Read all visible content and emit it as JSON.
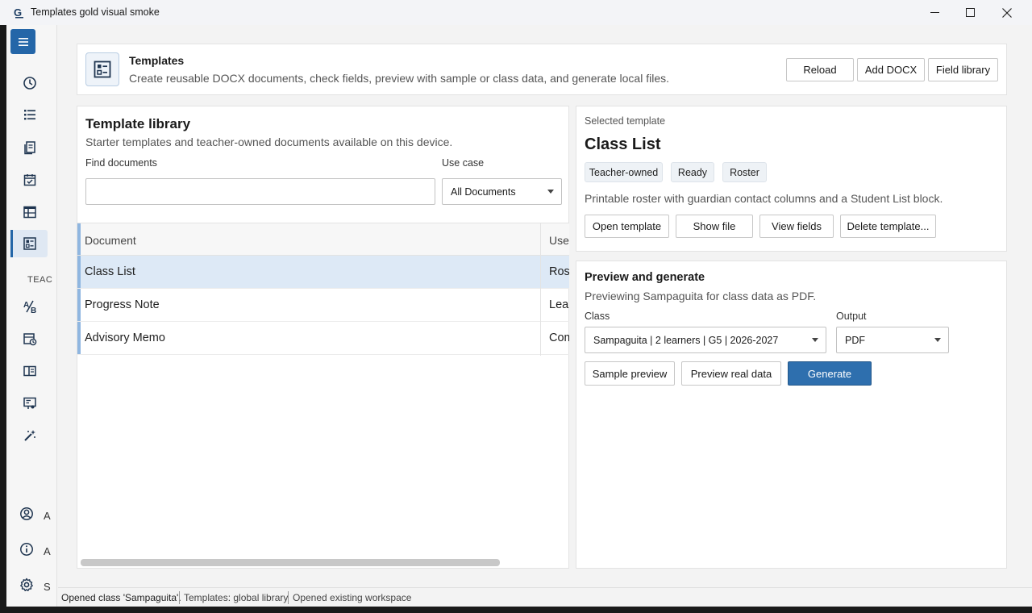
{
  "window": {
    "title": "Templates gold visual smoke"
  },
  "sidebar": {
    "section_label": "TEAC",
    "bottom_items_truncated": [
      "A",
      "A",
      "S"
    ]
  },
  "header": {
    "title": "Templates",
    "subtitle": "Create reusable DOCX documents, check fields, preview with sample or class data, and generate local files.",
    "buttons": {
      "reload": "Reload",
      "add_docx": "Add DOCX",
      "field_library": "Field library"
    }
  },
  "library": {
    "title": "Template library",
    "subtitle": "Starter templates and teacher-owned documents available on this device.",
    "find_label": "Find documents",
    "find_value": "",
    "usecase_label": "Use case",
    "usecase_value": "All Documents",
    "columns": [
      "Document",
      "Use"
    ],
    "rows": [
      {
        "document": "Class List",
        "use": "Rost"
      },
      {
        "document": "Progress Note",
        "use": "Lear"
      },
      {
        "document": "Advisory Memo",
        "use": "Com"
      }
    ]
  },
  "selected": {
    "label": "Selected template",
    "name": "Class List",
    "chips": [
      "Teacher-owned",
      "Ready",
      "Roster"
    ],
    "description": "Printable roster with guardian contact columns and a Student List block.",
    "buttons": {
      "open": "Open template",
      "show_file": "Show file",
      "view_fields": "View fields",
      "delete": "Delete template..."
    }
  },
  "preview": {
    "title": "Preview and generate",
    "subtitle": "Previewing Sampaguita for class data as PDF.",
    "class_label": "Class",
    "class_value": "Sampaguita | 2 learners | G5 | 2026-2027",
    "output_label": "Output",
    "output_value": "PDF",
    "buttons": {
      "sample": "Sample preview",
      "real": "Preview real data",
      "generate": "Generate"
    }
  },
  "status": {
    "items": [
      "Opened class 'Sampaguita'.",
      "Templates: global library",
      "Opened existing workspace"
    ]
  },
  "colors": {
    "accent": "#2466a8",
    "selected_row": "#dde9f6"
  }
}
